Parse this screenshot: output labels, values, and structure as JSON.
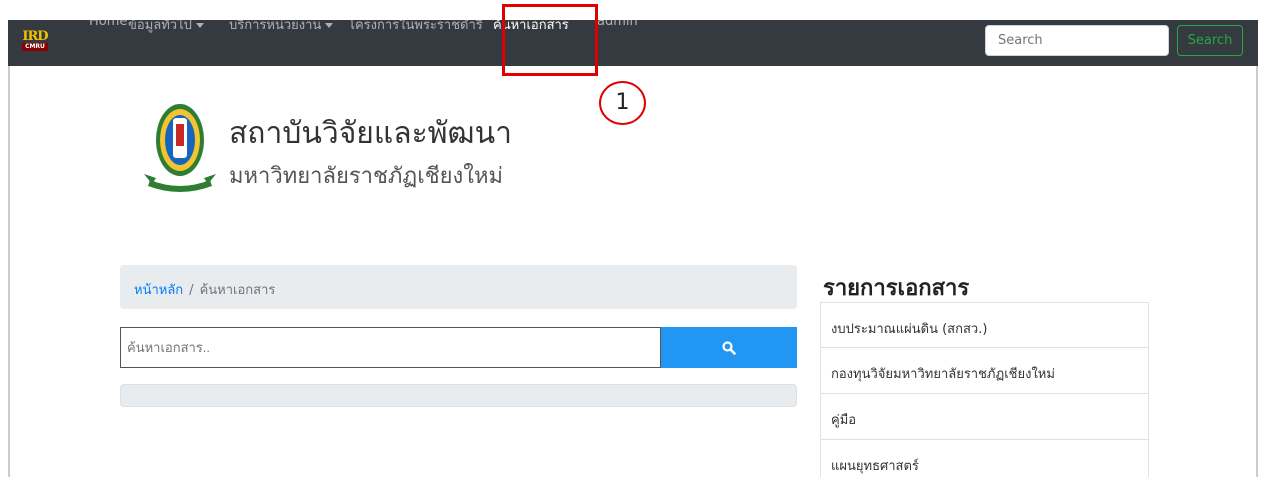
{
  "navbar": {
    "logo_top": "IRD",
    "logo_bottom": "CMRU",
    "items": [
      {
        "label": "Home"
      },
      {
        "label": "ข้อมูลทั่วไป"
      },
      {
        "label": "บริการหน่วยงาน"
      },
      {
        "label": "โครงการในพระราชดำริ"
      },
      {
        "label": "ค้นหาเอกสาร"
      },
      {
        "label": "admin"
      }
    ],
    "search_placeholder": "Search",
    "search_button": "Search"
  },
  "annotation": {
    "number": "1",
    "color": "#e00000"
  },
  "header": {
    "title": "สถาบันวิจัยและพัฒนา",
    "subtitle": "มหาวิทยาลัยราชภัฏเชียงใหม่"
  },
  "breadcrumb": {
    "home": "หน้าหลัก",
    "separator": "/",
    "current": "ค้นหาเอกสาร"
  },
  "doc_search": {
    "placeholder": "ค้นหาเอกสาร..",
    "button_icon": "search-icon",
    "button_color": "#2196f3"
  },
  "sidebar": {
    "title": "รายการเอกสาร",
    "items": [
      {
        "label": "งบประมาณแผ่นดิน (สกสว.)"
      },
      {
        "label": "กองทุนวิจัยมหาวิทยาลัยราชภัฏเชียงใหม่"
      },
      {
        "label": "คู่มือ"
      },
      {
        "label": "แผนยุทธศาสตร์"
      }
    ]
  }
}
